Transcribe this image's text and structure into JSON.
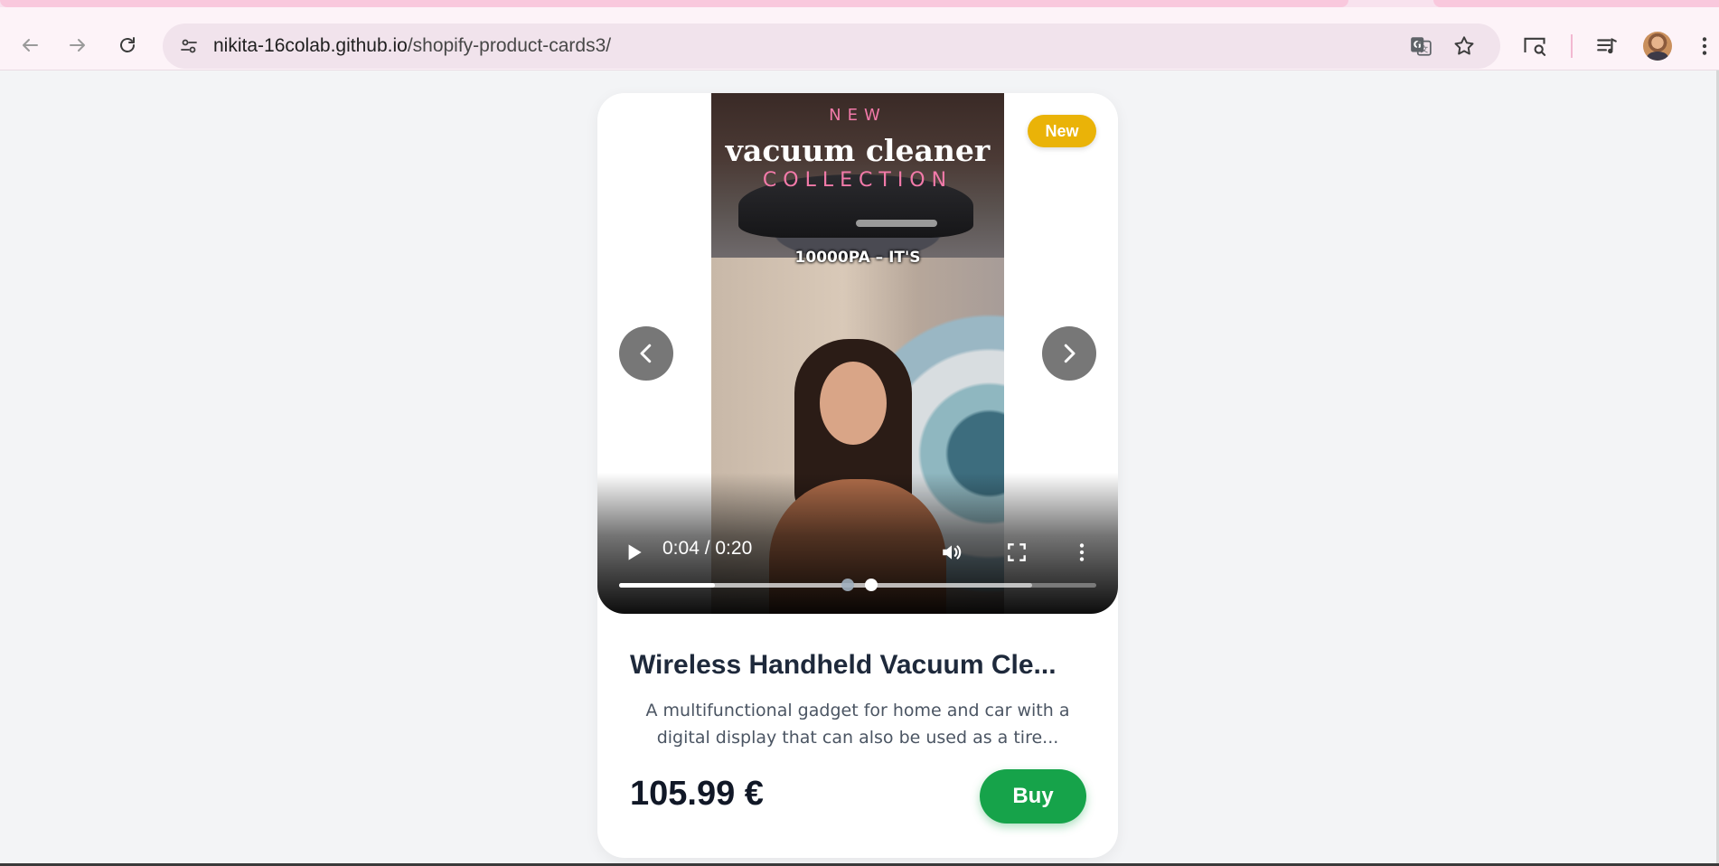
{
  "browser": {
    "url_host": "nikita-16colab.github.io",
    "url_path": "/shopify-product-cards3/",
    "icons": {
      "back": "back-arrow-icon",
      "forward": "forward-arrow-icon",
      "reload": "reload-icon",
      "site_info": "tune-icon",
      "translate": "translate-icon",
      "bookmark": "star-icon",
      "lens": "search-screen-icon",
      "media": "media-control-icon",
      "profile": "avatar",
      "menu": "kebab-menu-icon"
    }
  },
  "card": {
    "badge": "New",
    "video": {
      "overlay_new": "NEW",
      "overlay_title": "vacuum cleaner",
      "overlay_collection": "COLLECTION",
      "caption": "10000PA – IT'S",
      "time_display": "0:04 / 0:20",
      "current_seconds": 4,
      "duration_seconds": 20
    },
    "carousel": {
      "slide_count": 2,
      "active_index": 1
    },
    "title": "Wireless Handheld Vacuum Cle...",
    "description": "A multifunctional gadget for home and car with a digital display that can also be used as a tire...",
    "price": "105.99 €",
    "buy_label": "Buy"
  },
  "colors": {
    "badge": "#eab308",
    "buy": "#16a34a",
    "title": "#1e293b",
    "page_bg": "#f3f4f6"
  }
}
